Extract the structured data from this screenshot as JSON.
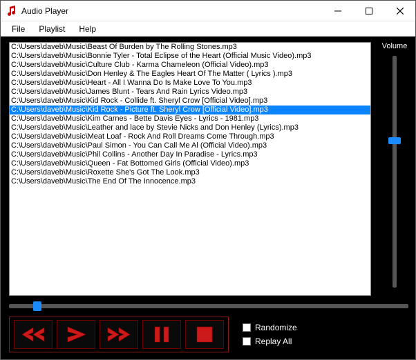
{
  "window": {
    "title": "Audio Player"
  },
  "menu": {
    "file": "File",
    "playlist": "Playlist",
    "help": "Help"
  },
  "playlist": {
    "items": [
      "C:\\Users\\daveb\\Music\\Beast Of Burden by The Rolling Stones.mp3",
      "C:\\Users\\daveb\\Music\\Bonnie Tyler - Total Eclipse of the Heart (Official Music Video).mp3",
      "C:\\Users\\daveb\\Music\\Culture Club - Karma Chameleon (Official Video).mp3",
      "C:\\Users\\daveb\\Music\\Don Henley & The Eagles Heart Of The Matter ( Lyrics ).mp3",
      "C:\\Users\\daveb\\Music\\Heart - All I Wanna Do Is Make Love To You.mp3",
      "C:\\Users\\daveb\\Music\\James Blunt - Tears And Rain Lyrics Video.mp3",
      "C:\\Users\\daveb\\Music\\Kid Rock - Collide ft. Sheryl Crow [Official Video].mp3",
      "C:\\Users\\daveb\\Music\\Kid Rock - Picture ft. Sheryl Crow [Official Video].mp3",
      "C:\\Users\\daveb\\Music\\Kim Carnes - Bette Davis Eyes - Lyrics - 1981.mp3",
      "C:\\Users\\daveb\\Music\\Leather and lace by Stevie Nicks and Don Henley (Lyrics).mp3",
      "C:\\Users\\daveb\\Music\\Meat Loaf - Rock And Roll Dreams Come Through.mp3",
      "C:\\Users\\daveb\\Music\\Paul Simon - You Can Call Me Al (Official Video).mp3",
      "C:\\Users\\daveb\\Music\\Phil Collins - Another Day In Paradise - Lyrics.mp3",
      "C:\\Users\\daveb\\Music\\Queen - Fat Bottomed Girls (Official Video).mp3",
      "C:\\Users\\daveb\\Music\\Roxette She's Got The Look.mp3",
      "C:\\Users\\daveb\\Music\\The End Of The Innocence.mp3"
    ],
    "selectedIndex": 7
  },
  "volume": {
    "label": "Volume",
    "pct": 65
  },
  "position": {
    "pct": 6
  },
  "options": {
    "randomize": "Randomize",
    "replay": "Replay All",
    "randomizeChecked": false,
    "replayChecked": false
  },
  "colors": {
    "accentRed": "#cc1a1a",
    "accentRedDark": "#6b0000",
    "sliderBlue": "#1a8cff",
    "selection": "#0a84ff"
  }
}
